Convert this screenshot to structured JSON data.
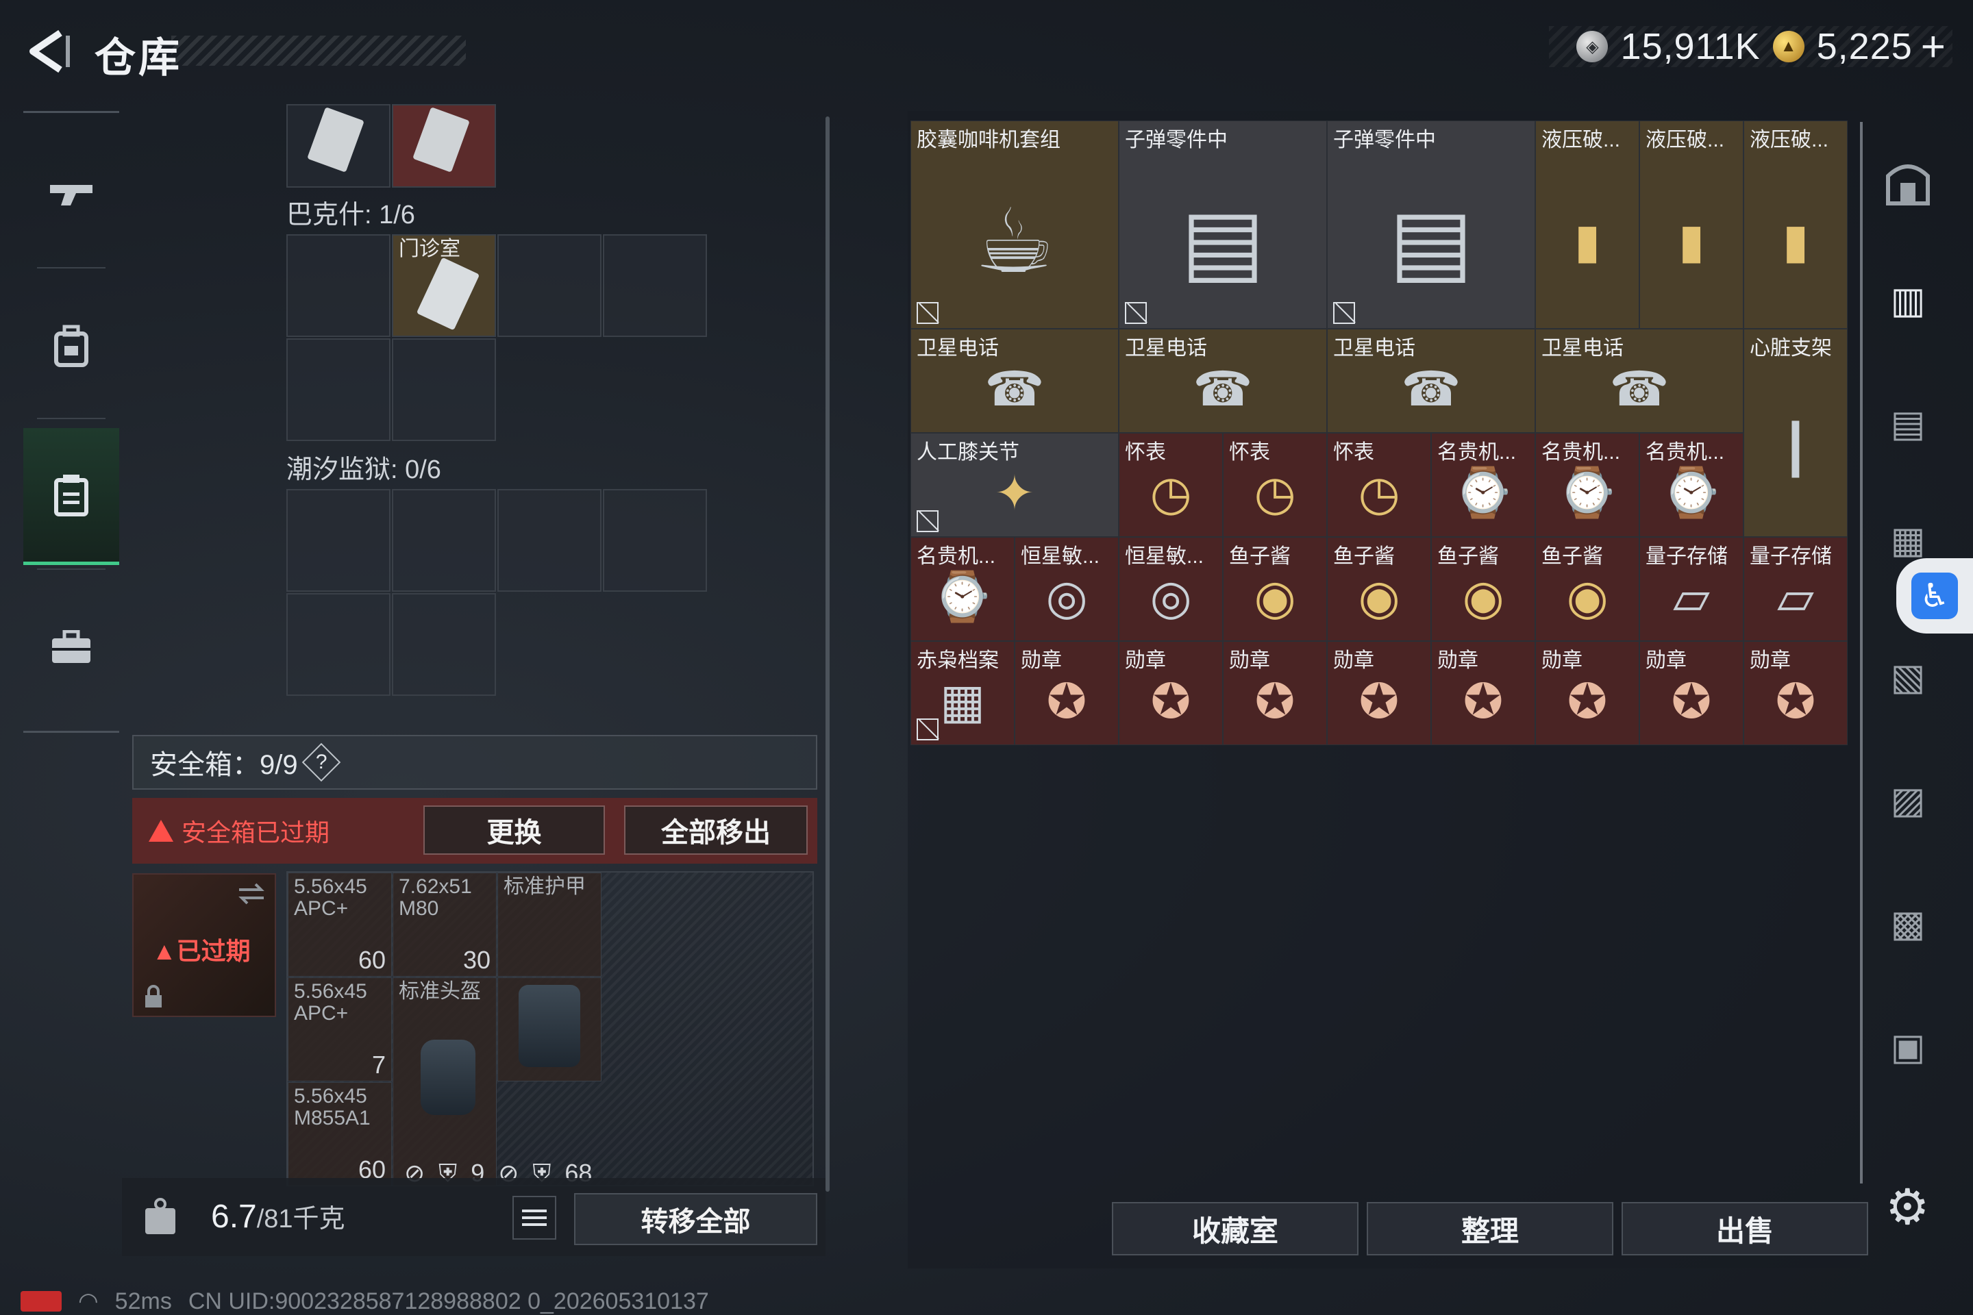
{
  "header": {
    "title": "仓库",
    "silver_amount": "15,911K",
    "gold_amount": "5,225",
    "gold_plus": "+"
  },
  "left_nav": [
    "gun-icon",
    "backpack-icon",
    "clipboard-icon",
    "briefcase-icon"
  ],
  "storage_sections": {
    "bakesh": "巴克什: 1/6",
    "bakesh_item_label": "门诊室",
    "tide_prison": "潮汐监狱: 0/6"
  },
  "safe_box": {
    "header": "安全箱：9/9",
    "help": "?",
    "expired_warning": "安全箱已过期",
    "replace_button": "更换",
    "remove_all_button": "全部移出",
    "expired_badge": "已过期",
    "cells": [
      {
        "label": "5.56x45\nAPC+",
        "count": "60"
      },
      {
        "label": "7.62x51\nM80",
        "count": "30"
      },
      {
        "label": "标准护甲",
        "count": ""
      },
      {
        "label": "5.56x45\nAPC+",
        "count": "7"
      },
      {
        "label": "标准头盔",
        "count": ""
      },
      {
        "label": "5.56x45\nM855A1",
        "count": "60"
      }
    ],
    "footer_stats": {
      "a": "9",
      "b": "68"
    }
  },
  "weight": {
    "value": "6.7",
    "unit": "/81千克"
  },
  "transfer_all_button": "转移全部",
  "right_items": [
    {
      "label": "胶囊咖啡机套组",
      "icon": "coffee-machine",
      "nolock": true
    },
    {
      "label": "子弹零件中",
      "icon": "ammo-parts",
      "nolock": true
    },
    {
      "label": "子弹零件中",
      "icon": "ammo-parts",
      "nolock": true
    },
    {
      "label": "液压破...",
      "icon": "hydraulic"
    },
    {
      "label": "液压破...",
      "icon": "hydraulic"
    },
    {
      "label": "液压破...",
      "icon": "hydraulic"
    },
    {
      "label": "卫星电话",
      "icon": "sat-phone"
    },
    {
      "label": "卫星电话",
      "icon": "sat-phone"
    },
    {
      "label": "卫星电话",
      "icon": "sat-phone"
    },
    {
      "label": "卫星电话",
      "icon": "sat-phone"
    },
    {
      "label": "心脏支架",
      "icon": "heart-stent"
    },
    {
      "label": "人工膝关节",
      "icon": "knee-joint",
      "nolock": true
    },
    {
      "label": "怀表",
      "icon": "pocket-watch"
    },
    {
      "label": "怀表",
      "icon": "pocket-watch"
    },
    {
      "label": "怀表",
      "icon": "pocket-watch"
    },
    {
      "label": "名贵机...",
      "icon": "luxury-watch"
    },
    {
      "label": "名贵机...",
      "icon": "luxury-watch"
    },
    {
      "label": "名贵机...",
      "icon": "luxury-watch"
    },
    {
      "label": "名贵机...",
      "icon": "luxury-watch"
    },
    {
      "label": "恒星敏...",
      "icon": "star-sensor"
    },
    {
      "label": "恒星敏...",
      "icon": "star-sensor"
    },
    {
      "label": "鱼子酱",
      "icon": "caviar"
    },
    {
      "label": "鱼子酱",
      "icon": "caviar"
    },
    {
      "label": "鱼子酱",
      "icon": "caviar"
    },
    {
      "label": "鱼子酱",
      "icon": "caviar"
    },
    {
      "label": "量子存储",
      "icon": "quantum-storage"
    },
    {
      "label": "量子存储",
      "icon": "quantum-storage"
    },
    {
      "label": "赤枭档案",
      "icon": "files",
      "nolock": true
    },
    {
      "label": "勋章",
      "icon": "medal"
    },
    {
      "label": "勋章",
      "icon": "medal"
    },
    {
      "label": "勋章",
      "icon": "medal"
    },
    {
      "label": "勋章",
      "icon": "medal"
    },
    {
      "label": "勋章",
      "icon": "medal"
    },
    {
      "label": "勋章",
      "icon": "medal"
    },
    {
      "label": "勋章",
      "icon": "medal"
    },
    {
      "label": "勋章",
      "icon": "medal"
    }
  ],
  "actions": {
    "collection_room": "收藏室",
    "organize": "整理",
    "sell": "出售"
  },
  "status": {
    "ping": "52ms",
    "uid": "CN UID:9002328587128988802 0_202605310137"
  },
  "colors": {
    "gold_cell": "#4a3f2a",
    "red_cell": "#4a2424",
    "accent_green": "#41c98a"
  }
}
